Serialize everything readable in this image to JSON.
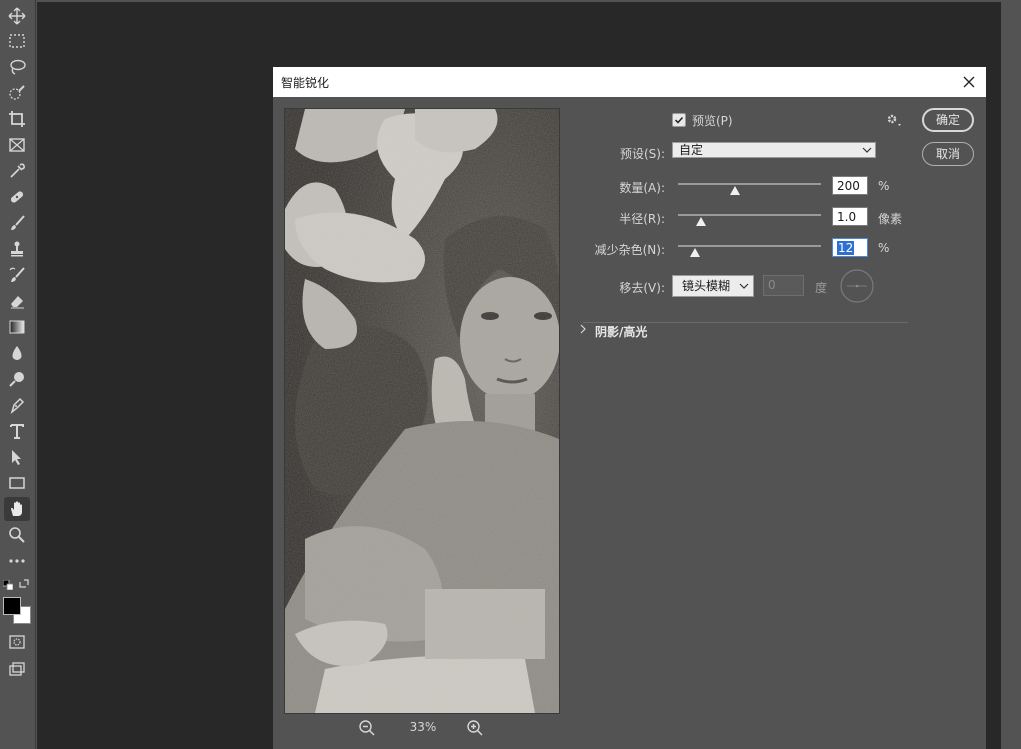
{
  "dialog": {
    "title": "智能锐化",
    "preview_label": "预览(P)",
    "preview_checked": true,
    "preset_label": "预设(S):",
    "preset_value": "自定",
    "amount_label": "数量(A):",
    "amount_value": "200",
    "amount_unit": "%",
    "amount_slider_fraction": 0.4,
    "radius_label": "半径(R):",
    "radius_value": "1.0",
    "radius_unit": "像素",
    "radius_slider_fraction": 0.16,
    "noise_label": "减少杂色(N):",
    "noise_value": "12",
    "noise_unit": "%",
    "noise_slider_fraction": 0.12,
    "remove_label": "移去(V):",
    "remove_value": "镜头模糊",
    "angle_value": "0",
    "angle_unit": "度",
    "shadows_label": "阴影/高光",
    "ok_button": "确定",
    "cancel_button": "取消",
    "zoom_level": "33%"
  },
  "toolbar": {
    "tools": [
      "move-icon",
      "marquee-icon",
      "lasso-icon",
      "quick-select-icon",
      "crop-icon",
      "frame-icon",
      "eyedropper-icon",
      "healing-icon",
      "brush-icon",
      "stamp-icon",
      "history-brush-icon",
      "eraser-icon",
      "gradient-icon",
      "blur-icon",
      "dodge-icon",
      "pen-icon",
      "type-icon",
      "path-select-icon",
      "rectangle-icon",
      "hand-icon",
      "zoom-icon",
      "more-icon",
      "quick-mask-icon",
      "screen-mode-icon"
    ],
    "active_tool": "hand-icon",
    "foreground_color": "#000000",
    "background_color": "#ffffff"
  }
}
